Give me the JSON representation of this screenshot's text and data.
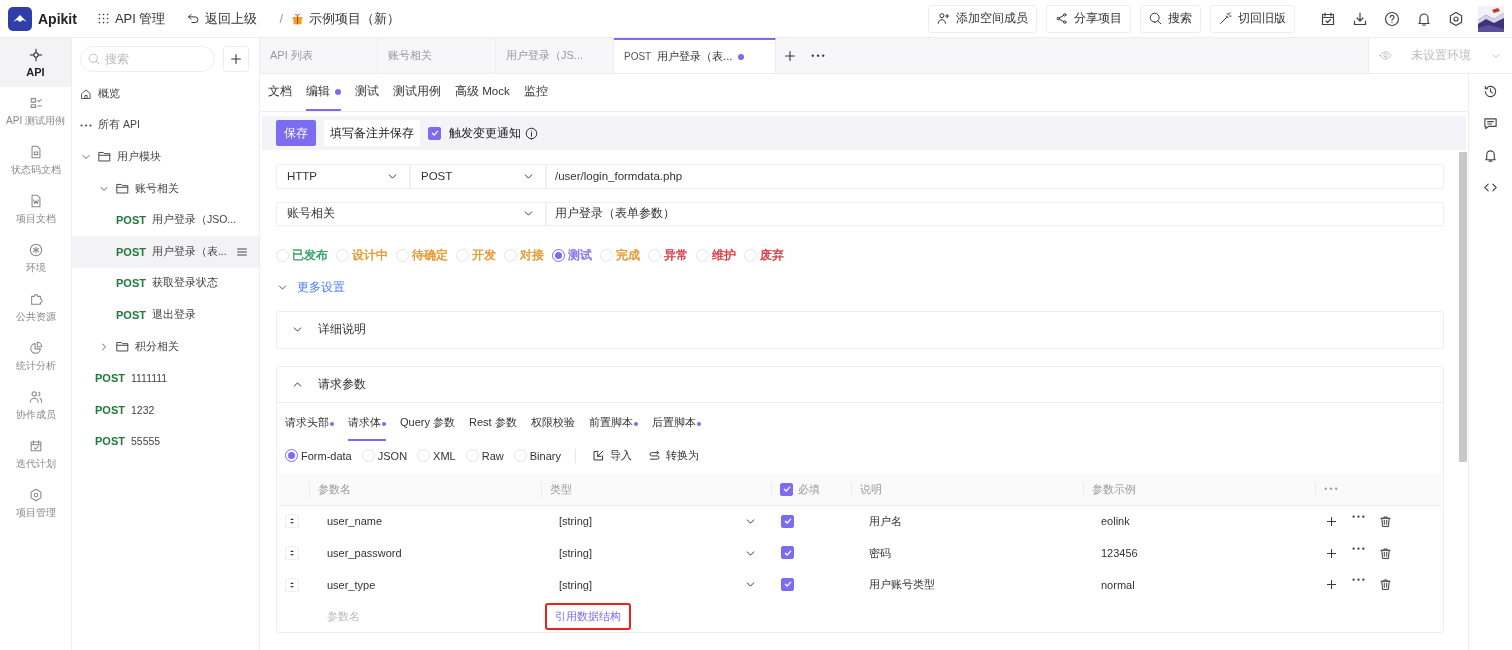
{
  "topbar": {
    "app_name": "Apikit",
    "nav": [
      {
        "kind": "module",
        "label": "API 管理"
      },
      {
        "kind": "back",
        "label": "返回上级"
      },
      {
        "kind": "separator",
        "label": "/"
      },
      {
        "kind": "project",
        "label": "示例项目（新）"
      }
    ],
    "actions": [
      {
        "kind": "invite",
        "label": "添加空间成员"
      },
      {
        "kind": "share",
        "label": "分享项目"
      },
      {
        "kind": "search",
        "label": "搜索"
      },
      {
        "kind": "switch",
        "label": "切回旧版"
      }
    ]
  },
  "rail": [
    {
      "label": "API",
      "selected": true
    },
    {
      "label": "API 测试用例",
      "selected": false
    },
    {
      "label": "状态码文档",
      "selected": false
    },
    {
      "label": "项目文档",
      "selected": false
    },
    {
      "label": "环境",
      "selected": false
    },
    {
      "label": "公共资源",
      "selected": false
    },
    {
      "label": "统计分析",
      "selected": false
    },
    {
      "label": "协作成员",
      "selected": false
    },
    {
      "label": "迭代计划",
      "selected": false
    },
    {
      "label": "项目管理",
      "selected": false
    }
  ],
  "tree": {
    "search_placeholder": "搜索",
    "items": [
      {
        "kind": "overview",
        "label": "概览",
        "selected": false
      },
      {
        "kind": "all",
        "label": "所有 API",
        "selected": false
      },
      {
        "kind": "folder",
        "label": "用户模块",
        "expanded": true,
        "selected": false,
        "children": [
          {
            "kind": "folder",
            "label": "账号相关",
            "expanded": true,
            "selected": false,
            "children": [
              {
                "kind": "api",
                "method": "POST",
                "label": "用户登录（JSO...",
                "selected": false
              },
              {
                "kind": "api",
                "method": "POST",
                "label": "用户登录（表...",
                "selected": true
              },
              {
                "kind": "api",
                "method": "POST",
                "label": "获取登录状态",
                "selected": false
              },
              {
                "kind": "api",
                "method": "POST",
                "label": "退出登录",
                "selected": false
              }
            ]
          },
          {
            "kind": "folder",
            "label": "积分相关",
            "expanded": false,
            "selected": false
          }
        ]
      },
      {
        "kind": "api",
        "method": "POST",
        "label": "1111111",
        "selected": false
      },
      {
        "kind": "api",
        "method": "POST",
        "label": "1232",
        "selected": false
      },
      {
        "kind": "api",
        "method": "POST",
        "label": "55555",
        "selected": false
      }
    ]
  },
  "tabs": [
    {
      "label": "API 列表",
      "selected": false,
      "unsaved": false
    },
    {
      "label": "账号相关",
      "selected": false,
      "unsaved": false
    },
    {
      "label": "用户登录（JS...",
      "selected": false,
      "unsaved": false
    },
    {
      "method": "POST",
      "label": "用户登录（表...",
      "selected": true,
      "unsaved": true
    }
  ],
  "env": {
    "placeholder": "未设置环境"
  },
  "editor_tabs": [
    {
      "label": "文档",
      "selected": false,
      "unsaved": false
    },
    {
      "label": "编辑",
      "selected": true,
      "unsaved": true
    },
    {
      "label": "测试",
      "selected": false,
      "unsaved": false
    },
    {
      "label": "测试用例",
      "selected": false,
      "unsaved": false
    },
    {
      "label": "高级 Mock",
      "selected": false,
      "unsaved": false
    },
    {
      "label": "监控",
      "selected": false,
      "unsaved": false
    }
  ],
  "toolbar": {
    "save": "保存",
    "save_with_note": "填写备注并保存",
    "notify": {
      "label": "触发变更通知",
      "checked": true
    }
  },
  "request": {
    "protocol": "HTTP",
    "method": "POST",
    "url": "/user/login_formdata.php",
    "group": "账号相关",
    "name": "用户登录（表单参数）"
  },
  "statuses": [
    {
      "label": "已发布",
      "color": "#2e9e63",
      "selected": false
    },
    {
      "label": "设计中",
      "color": "#e5952c",
      "selected": false
    },
    {
      "label": "待确定",
      "color": "#e5952c",
      "selected": false
    },
    {
      "label": "开发",
      "color": "#e5952c",
      "selected": false
    },
    {
      "label": "对接",
      "color": "#e5952c",
      "selected": false
    },
    {
      "label": "测试",
      "color": "#7b6cf0",
      "selected": true
    },
    {
      "label": "完成",
      "color": "#e5952c",
      "selected": false
    },
    {
      "label": "异常",
      "color": "#d9363e",
      "selected": false
    },
    {
      "label": "维护",
      "color": "#d9363e",
      "selected": false
    },
    {
      "label": "废弃",
      "color": "#d9363e",
      "selected": false
    }
  ],
  "more_settings": {
    "label": "更多设置",
    "expanded": false
  },
  "detail_panel": {
    "title": "详细说明",
    "expanded": false
  },
  "params_panel": {
    "title": "请求参数",
    "expanded": true,
    "tabs": [
      {
        "label": "请求头部",
        "selected": false,
        "has_content": true
      },
      {
        "label": "请求体",
        "selected": true,
        "has_content": true
      },
      {
        "label": "Query 参数",
        "selected": false,
        "has_content": false
      },
      {
        "label": "Rest 参数",
        "selected": false,
        "has_content": false
      },
      {
        "label": "权限校验",
        "selected": false,
        "has_content": false
      },
      {
        "label": "前置脚本",
        "selected": false,
        "has_content": true
      },
      {
        "label": "后置脚本",
        "selected": false,
        "has_content": true
      }
    ],
    "body_types": [
      {
        "label": "Form-data",
        "selected": true
      },
      {
        "label": "JSON",
        "selected": false
      },
      {
        "label": "XML",
        "selected": false
      },
      {
        "label": "Raw",
        "selected": false
      },
      {
        "label": "Binary",
        "selected": false
      }
    ],
    "actions": [
      {
        "kind": "import",
        "label": "导入"
      },
      {
        "kind": "convert",
        "label": "转换为"
      }
    ],
    "table": {
      "columns": [
        {
          "label": "参数名"
        },
        {
          "label": "类型"
        },
        {
          "label": "必填",
          "checked": true
        },
        {
          "label": "说明"
        },
        {
          "label": "参数示例"
        }
      ],
      "rows": [
        {
          "name": "user_name",
          "type": "[string]",
          "required": true,
          "description": "用户名",
          "example": "eolink"
        },
        {
          "name": "user_password",
          "type": "[string]",
          "required": true,
          "description": "密码",
          "example": "123456"
        },
        {
          "name": "user_type",
          "type": "[string]",
          "required": true,
          "description": "用户账号类型",
          "example": "normal"
        }
      ],
      "new_row": {
        "placeholder": "参数名",
        "link": "引用数据结构",
        "highlighted": true
      }
    }
  }
}
